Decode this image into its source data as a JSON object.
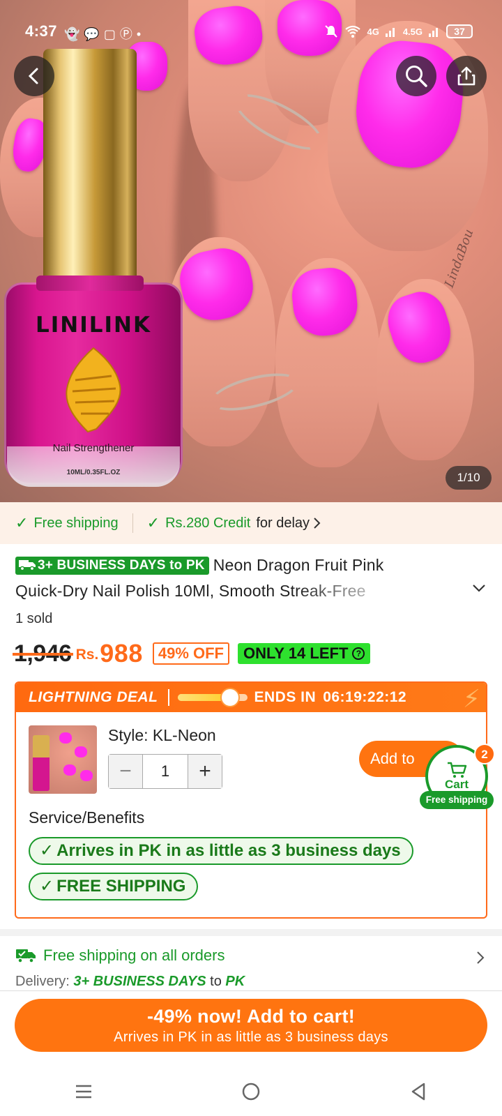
{
  "status_bar": {
    "time": "4:37",
    "notification_icons": [
      "snapchat-icon",
      "chat-icon",
      "screenshot-icon",
      "pinterest-icon",
      "dot-icon"
    ],
    "network_1": "4G",
    "network_2": "4.5G",
    "battery": "37"
  },
  "hero": {
    "bottle_brand": "LINILINK",
    "bottle_subtitle": "Nail Strengthener",
    "bottle_volume": "10ML/0.35FL.OZ",
    "signature": "LindaBou",
    "image_counter": "1/10",
    "image_index": 1,
    "image_total": 10
  },
  "shipping_strip": {
    "free_shipping": "Free shipping",
    "credit_amount": "Rs.280 Credit",
    "credit_suffix": "for delay"
  },
  "product": {
    "badge": "3+ BUSINESS DAYS to PK",
    "title_line1": "Neon Dragon Fruit Pink",
    "title_line2": "Quick-Dry Nail Polish 10Ml, Smooth Streak-Free",
    "sold": "1 sold",
    "old_price": "1,946",
    "currency": "Rs.",
    "price": "988",
    "discount": "49% OFF",
    "stock": "ONLY 14 LEFT"
  },
  "deal": {
    "label": "LIGHTNING DEAL",
    "ends_label": "ENDS IN",
    "countdown": "06:19:22:12",
    "progress_fraction": 0.75,
    "style_label": "Style: KL-Neon",
    "quantity": "1",
    "add_button": "Add to",
    "service_title": "Service/Benefits",
    "benefit_1": "Arrives in PK in as little as 3 business days",
    "benefit_2": "FREE SHIPPING"
  },
  "cart": {
    "label": "Cart",
    "count": "2",
    "free_shipping": "Free shipping"
  },
  "delivery": {
    "free_all": "Free shipping on all orders",
    "label": "Delivery:",
    "days": "3+ BUSINESS DAYS",
    "to": "to",
    "country": "PK"
  },
  "cta": {
    "line1": "-49% now! Add to cart!",
    "line2": "Arrives in PK in as little as 3 business days"
  },
  "colors": {
    "accent_orange": "#ff7410",
    "green": "#1a9a2a",
    "stock_green": "#2ee02e",
    "nail_pink": "#ff2bea"
  }
}
